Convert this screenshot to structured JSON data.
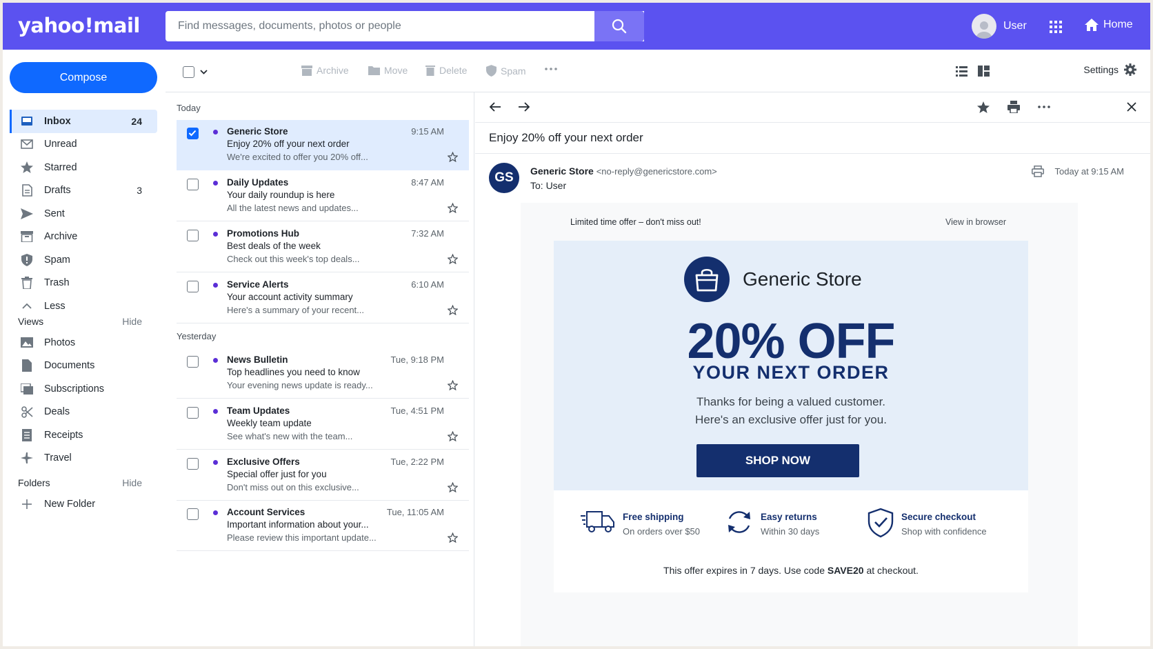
{
  "header": {
    "logo": "yahoo!mail",
    "search_placeholder": "Find messages, documents, photos or people",
    "user_label": "User",
    "home_label": "Home",
    "brand_color": "#5b52f0"
  },
  "sidebar": {
    "compose_label": "Compose",
    "items": [
      {
        "label": "Inbox",
        "count": "24",
        "icon": "inbox-icon"
      },
      {
        "label": "Unread",
        "count": "",
        "icon": "envelope-icon"
      },
      {
        "label": "Starred",
        "count": "",
        "icon": "star-icon"
      },
      {
        "label": "Drafts",
        "count": "3",
        "icon": "draft-icon"
      },
      {
        "label": "Sent",
        "count": "",
        "icon": "send-icon"
      },
      {
        "label": "Archive",
        "count": "",
        "icon": "archive-icon"
      },
      {
        "label": "Spam",
        "count": "",
        "icon": "shield-icon"
      },
      {
        "label": "Trash",
        "count": "",
        "icon": "trash-icon"
      },
      {
        "label": "Less",
        "count": "",
        "icon": "chevron-up-icon"
      }
    ],
    "views_title": "Views",
    "views_hide": "Hide",
    "views": [
      {
        "label": "Photos",
        "icon": "photo-icon"
      },
      {
        "label": "Documents",
        "icon": "document-icon"
      },
      {
        "label": "Subscriptions",
        "icon": "newsletter-icon"
      },
      {
        "label": "Deals",
        "icon": "scissors-icon"
      },
      {
        "label": "Receipts",
        "icon": "receipt-icon"
      },
      {
        "label": "Travel",
        "icon": "plane-icon"
      }
    ],
    "folders_title": "Folders",
    "folders_hide": "Hide",
    "new_folder": "New Folder"
  },
  "toolbar": {
    "archive": "Archive",
    "move": "Move",
    "delete": "Delete",
    "spam": "Spam",
    "settings": "Settings"
  },
  "list": {
    "today_label": "Today",
    "yesterday_label": "Yesterday",
    "today": [
      {
        "from": "Generic Store",
        "subject": "Enjoy 20% off your next order",
        "snippet": "We're excited to offer you 20% off...",
        "time": "9:15 AM",
        "selected": true
      },
      {
        "from": "Daily Updates",
        "subject": "Your daily roundup is here",
        "snippet": "All the latest news and updates...",
        "time": "8:47 AM",
        "selected": false
      },
      {
        "from": "Promotions Hub",
        "subject": "Best deals of the week",
        "snippet": "Check out this week's top deals...",
        "time": "7:32 AM",
        "selected": false
      },
      {
        "from": "Service Alerts",
        "subject": "Your account activity summary",
        "snippet": "Here's a summary of your recent...",
        "time": "6:10 AM",
        "selected": false
      }
    ],
    "yesterday": [
      {
        "from": "News Bulletin",
        "subject": "Top headlines you need to know",
        "snippet": "Your evening news update is ready...",
        "time": "Tue, 9:18 PM"
      },
      {
        "from": "Team Updates",
        "subject": "Weekly team update",
        "snippet": "See what's new with the team...",
        "time": "Tue, 4:51 PM"
      },
      {
        "from": "Exclusive Offers",
        "subject": "Special offer just for you",
        "snippet": "Don't miss out on this exclusive...",
        "time": "Tue, 2:22 PM"
      },
      {
        "from": "Account Services",
        "subject": "Important information about your...",
        "snippet": "Please review this important update...",
        "time": "Tue, 11:05 AM"
      }
    ]
  },
  "reader": {
    "subject": "Enjoy 20% off your next order",
    "avatar_initials": "GS",
    "sender_name": "Generic Store",
    "sender_addr": "<no-reply@genericstore.com>",
    "to_line": "To:  User",
    "date": "Today at 9:15 AM",
    "body": {
      "top_note": "Limited time offer – don't miss out!",
      "view_browser": "View in browser",
      "brand": "Generic Store",
      "headline": "20% OFF",
      "subhead": "YOUR NEXT ORDER",
      "thanks1": "Thanks for being a valued customer.",
      "thanks2": "Here's an exclusive offer just for you.",
      "cta": "SHOP NOW",
      "features": [
        {
          "title": "Free shipping",
          "sub": "On orders over $50",
          "icon": "truck-icon"
        },
        {
          "title": "Easy returns",
          "sub": "Within 30 days",
          "icon": "refresh-icon"
        },
        {
          "title": "Secure checkout",
          "sub": "Shop with confidence",
          "icon": "shield-check-icon"
        }
      ],
      "expires_pre": "This offer expires in 7 days. Use code ",
      "expires_code": "SAVE20",
      "expires_post": " at checkout.",
      "accent_color": "#142f6e"
    }
  }
}
